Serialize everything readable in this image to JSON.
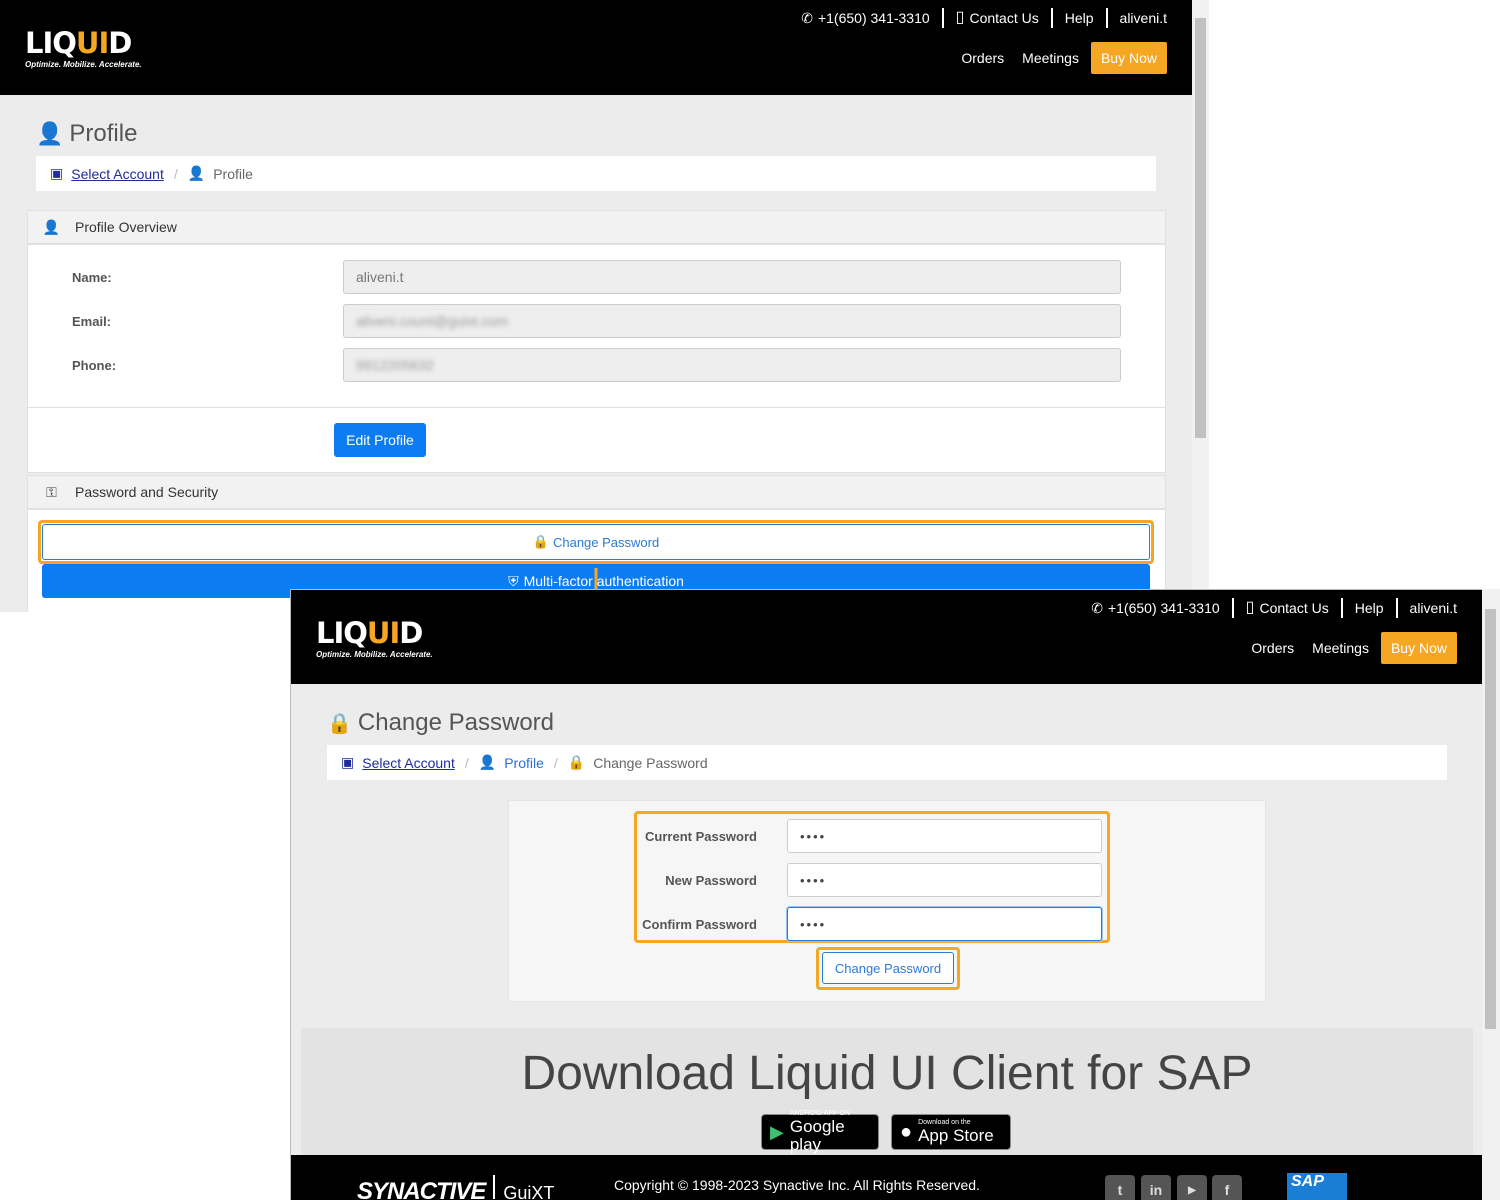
{
  "header": {
    "logo_main": "LIQ",
    "logo_accent": "UI",
    "logo_end": "D",
    "tagline": "Optimize. Mobilize. Accelerate.",
    "phone": "+1(650) 341-3310",
    "contact": "Contact Us",
    "help": "Help",
    "user": "aliveni.t",
    "nav_orders": "Orders",
    "nav_meetings": "Meetings",
    "buy_now": "Buy Now"
  },
  "profile": {
    "title": "Profile",
    "crumb_select": "Select Account",
    "crumb_profile": "Profile",
    "overview_title": "Profile Overview",
    "name_label": "Name:",
    "name_value": "aliveni.t",
    "email_label": "Email:",
    "email_value": "aliveni.count@guixt.com",
    "phone_label": "Phone:",
    "phone_value": "9912205632",
    "edit_button": "Edit Profile",
    "security_title": "Password and Security",
    "change_password_button": "Change Password",
    "mfa_button": "Multi-factor authentication"
  },
  "change_password": {
    "title": "Change Password",
    "crumb_select": "Select Account",
    "crumb_profile": "Profile",
    "crumb_current": "Change Password",
    "current_label": "Current Password",
    "current_value": "••••",
    "new_label": "New Password",
    "new_value": "••••",
    "confirm_label": "Confirm Password",
    "confirm_value": "••••",
    "submit_button": "Change Password",
    "download_title": "Download Liquid UI Client for SAP",
    "google_small": "ANDROID APP ON",
    "google_big": "Google play",
    "apple_small": "Download on the",
    "apple_big": "App Store",
    "footer_brand": "SYNACTIVE",
    "footer_sub": "GuiXT",
    "copyright": "Copyright © 1998-2023 Synactive Inc. All Rights Reserved.",
    "sap": "SAP"
  },
  "colors": {
    "accent": "#f5a623",
    "primary": "#0d7cf2",
    "link": "#1f2d9a"
  }
}
